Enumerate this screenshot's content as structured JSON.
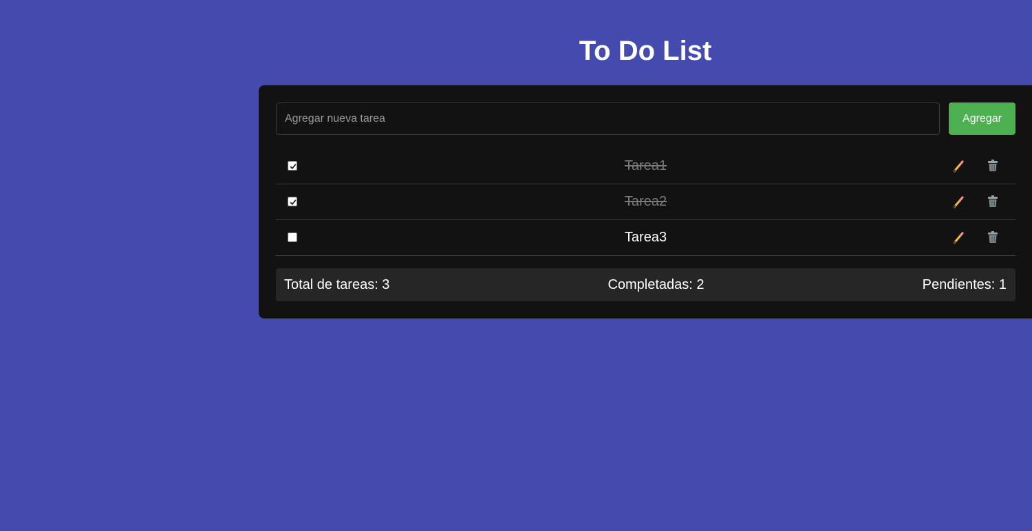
{
  "header": {
    "title": "To Do List"
  },
  "form": {
    "placeholder": "Agregar nueva tarea",
    "value": "",
    "add_label": "Agregar"
  },
  "tasks": [
    {
      "text": "Tarea1",
      "completed": true,
      "edit_icon": "pencil-icon",
      "delete_icon": "trash-icon"
    },
    {
      "text": "Tarea2",
      "completed": true,
      "edit_icon": "pencil-icon",
      "delete_icon": "trash-icon"
    },
    {
      "text": "Tarea3",
      "completed": false,
      "edit_icon": "pencil-icon",
      "delete_icon": "trash-icon"
    }
  ],
  "stats": {
    "total": "Total de tareas: 3",
    "completed": "Completadas: 2",
    "pending": "Pendientes: 1"
  },
  "colors": {
    "background": "#454aae",
    "card": "#121212",
    "accent": "#4caf50",
    "completed_text": "#7a7a7a"
  }
}
